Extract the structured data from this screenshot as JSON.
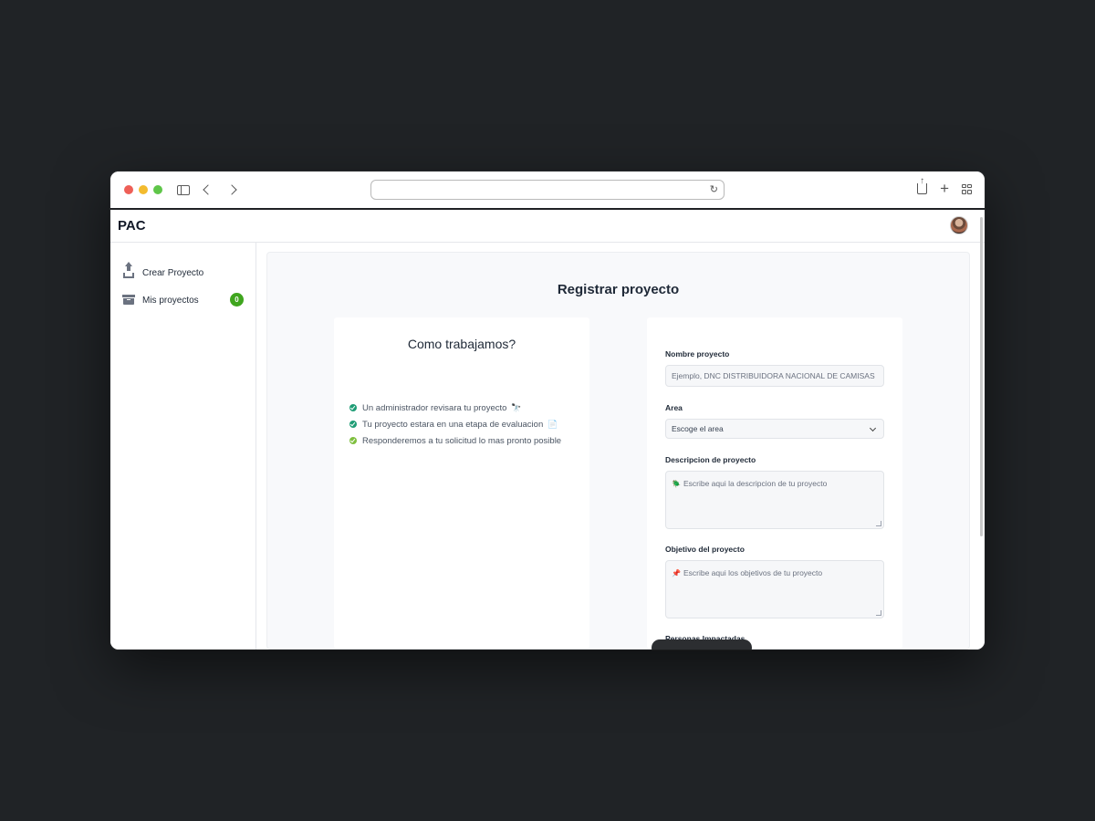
{
  "browser": {
    "url": ""
  },
  "app": {
    "brand": "PAC"
  },
  "sidebar": {
    "items": [
      {
        "label": "Crear Proyecto",
        "icon": "upload-icon"
      },
      {
        "label": "Mis proyectos",
        "icon": "archive-icon",
        "badge": "0"
      }
    ]
  },
  "page": {
    "title": "Registrar proyecto"
  },
  "info_card": {
    "title": "Como trabajamos?",
    "steps": [
      {
        "text": "Un administrador revisara tu proyecto",
        "emoji": "🔭",
        "color": "#1f9d76"
      },
      {
        "text": "Tu proyecto estara en una etapa de evaluacion",
        "emoji": "📄",
        "color": "#1f9d76"
      },
      {
        "text": "Responderemos a tu solicitud lo mas pronto posible",
        "emoji": "",
        "color": "#7fbf3f"
      }
    ]
  },
  "form": {
    "name_label": "Nombre proyecto",
    "name_placeholder": "Ejemplo, DNC DISTRIBUIDORA NACIONAL DE CAMISAS",
    "area_label": "Area",
    "area_selected": "Escoge el area",
    "description_label": "Descripcion de proyecto",
    "description_icon": "🪲",
    "description_placeholder": "Escribe aqui la descripcion de tu proyecto",
    "objective_label": "Objetivo del proyecto",
    "objective_icon": "📌",
    "objective_placeholder": "Escribe aqui los objetivos de tu proyecto",
    "impacted_label": "Personas Impactadas"
  },
  "colors": {
    "badge": "#3fa51e",
    "check_green": "#1f9d76",
    "check_lime": "#7fbf3f"
  }
}
